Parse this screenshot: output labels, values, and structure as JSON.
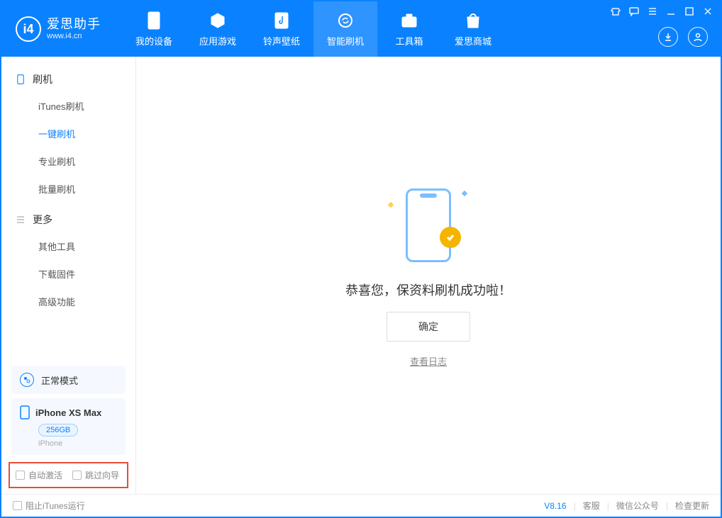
{
  "app": {
    "title": "爱思助手",
    "subtitle": "www.i4.cn"
  },
  "nav": {
    "items": [
      {
        "label": "我的设备"
      },
      {
        "label": "应用游戏"
      },
      {
        "label": "铃声壁纸"
      },
      {
        "label": "智能刷机"
      },
      {
        "label": "工具箱"
      },
      {
        "label": "爱思商城"
      }
    ]
  },
  "sidebar": {
    "section1": {
      "title": "刷机",
      "items": [
        "iTunes刷机",
        "一键刷机",
        "专业刷机",
        "批量刷机"
      ]
    },
    "section2": {
      "title": "更多",
      "items": [
        "其他工具",
        "下载固件",
        "高级功能"
      ]
    },
    "mode_label": "正常模式",
    "device": {
      "name": "iPhone XS Max",
      "capacity": "256GB",
      "type": "iPhone"
    },
    "check1": "自动激活",
    "check2": "跳过向导"
  },
  "main": {
    "message": "恭喜您，保资料刷机成功啦！",
    "ok": "确定",
    "log_link": "查看日志"
  },
  "footer": {
    "block_itunes": "阻止iTunes运行",
    "version": "V8.16",
    "support": "客服",
    "wechat": "微信公众号",
    "update": "检查更新"
  }
}
